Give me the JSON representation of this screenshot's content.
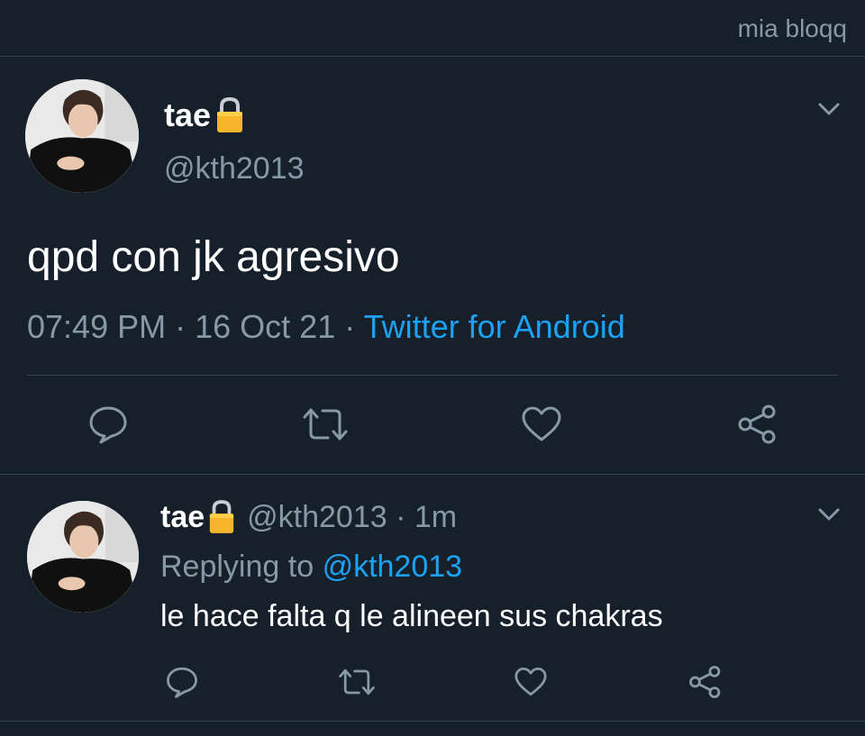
{
  "watermark": "mia bloqq",
  "tweet": {
    "display_name": "tae",
    "handle": "@kth2013",
    "text": "qpd con jk agresivo",
    "time": "07:49 PM",
    "separator": "·",
    "date": "16 Oct 21",
    "source": "Twitter for Android"
  },
  "reply": {
    "display_name": "tae",
    "handle_time": "@kth2013 · 1m",
    "replying_prefix": "Replying to",
    "replying_to": "@kth2013",
    "text": "le hace falta q le alineen sus chakras"
  },
  "icons": {
    "lock": "lock-icon",
    "chevron": "chevron-down-icon",
    "reply": "comment-icon",
    "retweet": "retweet-icon",
    "like": "heart-icon",
    "share": "share-icon"
  },
  "colors": {
    "background": "#15202b",
    "secondary_text": "#8899a6",
    "link": "#1da1f2",
    "divider": "#38444d"
  }
}
